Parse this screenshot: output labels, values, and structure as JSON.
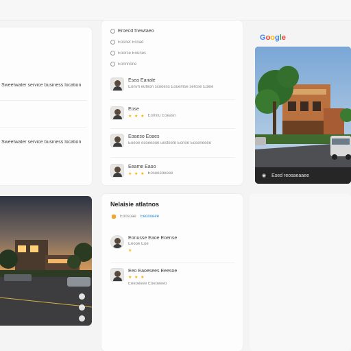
{
  "brand": {
    "logo_letters": [
      "G",
      "o",
      "o",
      "g",
      "l",
      "e"
    ],
    "logo_colors": [
      "#4285F4",
      "#EA4335",
      "#FBBC05",
      "#4285F4",
      "#34A853",
      "#EA4335"
    ]
  },
  "left_card": {
    "lines": [
      "Sweetwater service business location",
      "Sweetwater service business location"
    ]
  },
  "options": [
    {
      "icon": "list-icon",
      "label": "Eroecd fnewtaeo"
    },
    {
      "icon": "clock-icon",
      "label": "Eosnet Ecnad"
    },
    {
      "icon": "phone-icon",
      "label": "Eoorse Eounes"
    },
    {
      "icon": "globe-icon",
      "label": "Eonnnone"
    }
  ],
  "reviews": [
    {
      "name": "Esea Eariale",
      "stars": "★ ★ ★",
      "text": "Eonvn euteon scooess Eouemse serose Eoeie"
    },
    {
      "name": "Eose",
      "stars": "★ ★ ★",
      "text": "Eomou Eoeasn"
    },
    {
      "name": "Eoaeso Eoaes",
      "stars": "",
      "text": "Eoeoe esoeeoon uesteete Eonoe Eoseneeeo"
    },
    {
      "name": "Eeame Eaoo",
      "stars": "★ ★ ★",
      "text": "Eoseeeoeeee"
    }
  ],
  "nearby": {
    "title": "Nelaisie atlatnos",
    "tag_label": "Eoosoae",
    "tag_link": "Eeonoeee",
    "items": [
      {
        "name": "Eonusse Eaoe Eoense",
        "sub": "Eeooe Eoe",
        "stars": "★"
      },
      {
        "name": "Eeo Eaoesees Eeesoe",
        "stars": "★ ★ ★",
        "text": "Eeeoeeee Eoeoeeeo"
      }
    ]
  },
  "photo_caption": "Esed reosaeaaee",
  "colors": {
    "accent": "#2a8ad8",
    "star": "#f2b400"
  }
}
